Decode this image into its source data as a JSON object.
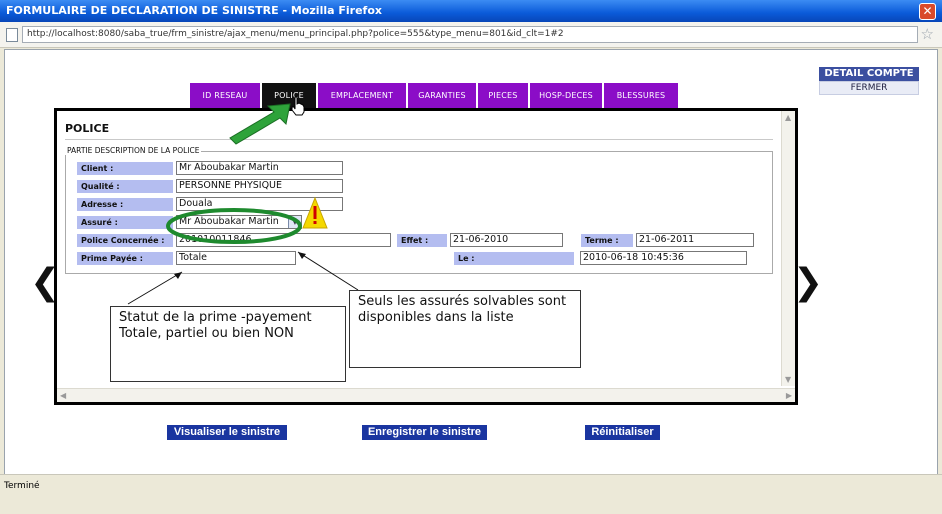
{
  "window": {
    "title": "FORMULAIRE DE DECLARATION DE SINISTRE - Mozilla Firefox",
    "url": "http://localhost:8080/saba_true/frm_sinistre/ajax_menu/menu_principal.php?police=555&type_menu=801&id_clt=1#2"
  },
  "status": "Terminé",
  "detail": {
    "header": "DETAIL COMPTE",
    "close_label": "FERMER"
  },
  "tabs": [
    {
      "label": "ID RESEAU",
      "active": false
    },
    {
      "label": "POLICE",
      "active": true
    },
    {
      "label": "EMPLACEMENT",
      "active": false
    },
    {
      "label": "GARANTIES",
      "active": false
    },
    {
      "label": "PIECES",
      "active": false
    },
    {
      "label": "HOSP-DECES",
      "active": false
    },
    {
      "label": "BLESSURES",
      "active": false
    }
  ],
  "police": {
    "title": "POLICE",
    "legend": "PARTIE DESCRIPTION DE LA POLICE",
    "client_label": "Client :",
    "client_value": "Mr Aboubakar Martin",
    "qualite_label": "Qualité :",
    "qualite_value": "PERSONNE PHYSIQUE",
    "adresse_label": "Adresse :",
    "adresse_value": "Douala",
    "assure_label": "Assuré :",
    "assure_value": "Mr Aboubakar Martin",
    "police_label": "Police Concernée :",
    "police_value": "201010011846",
    "effet_label": "Effet :",
    "effet_value": "21-06-2010",
    "terme_label": "Terme :",
    "terme_value": "21-06-2011",
    "prime_label": "Prime Payée :",
    "prime_value": "Totale",
    "le_label": "Le :",
    "le_value": "2010-06-18 10:45:36"
  },
  "callouts": {
    "prime": "Statut de la prime -payement Totale, partiel ou bien NON",
    "assures": "Seuls les assurés solvables sont disponibles dans la liste"
  },
  "buttons": {
    "visualiser": "Visualiser le sinistre",
    "enregistrer": "Enregistrer le sinistre",
    "reinitialiser": "Réinitialiser"
  },
  "colors": {
    "tab": "#8b0dc7",
    "tab_active": "#111111",
    "label_bg": "#b4bdf0",
    "button": "#1a35a0",
    "highlight": "#1e8a2e",
    "warning": "#f5d800"
  }
}
